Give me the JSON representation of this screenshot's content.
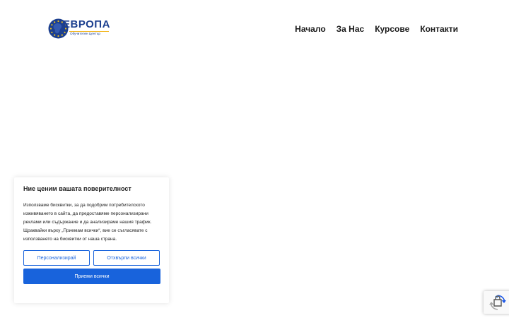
{
  "logo": {
    "wordmark": "ЕВРОПА",
    "tagline": "Обучителен Център",
    "icon": "eu-stars-globe-icon"
  },
  "nav": {
    "items": [
      {
        "label": "Начало"
      },
      {
        "label": "За Нас"
      },
      {
        "label": "Курсове"
      },
      {
        "label": "Контакти"
      }
    ]
  },
  "consent": {
    "title": "Ние ценим вашата поверителност",
    "text": "Използваме бисквитки, за да подобрим потребителското изживяването в сайта, да предоставяме персонализирани реклами или съдържание и да анализираме нашия трафик. Щраквайки върху „Приемам всички“, вие се съгласявате с използването на бисквитки от наша страна.",
    "customize_label": "Персонализирай",
    "reject_label": "Отхвърли всички",
    "accept_label": "Приеми всички"
  },
  "recaptcha": {
    "icon": "recaptcha-icon"
  },
  "colors": {
    "brand": "#1c3f8f",
    "accent": "#f2b51c",
    "button": "#1863dc"
  }
}
